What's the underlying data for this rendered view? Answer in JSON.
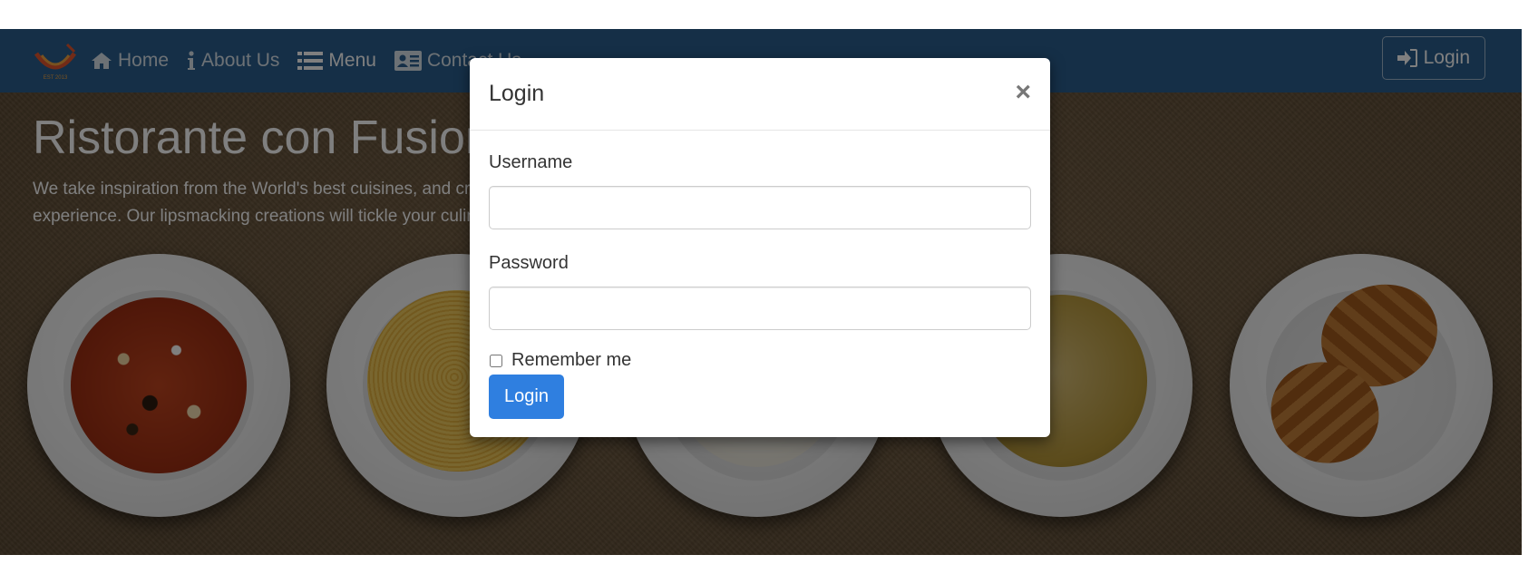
{
  "navbar": {
    "items": [
      {
        "label": "Home",
        "icon": "home-icon"
      },
      {
        "label": "About Us",
        "icon": "info-icon"
      },
      {
        "label": "Menu",
        "icon": "list-icon"
      },
      {
        "label": "Contact Us",
        "icon": "address-card-icon"
      }
    ],
    "active_item": "Menu",
    "login_label": "Login"
  },
  "hero": {
    "title": "Ristorante con Fusion",
    "text_line1": "We take inspiration from the World's best cuisines, and create a unique fusion",
    "text_line2": "experience. Our lipsmacking creations will tickle your culinary senses!"
  },
  "modal": {
    "title": "Login",
    "close_symbol": "×",
    "username_label": "Username",
    "username_value": "",
    "password_label": "Password",
    "password_value": "",
    "remember_label": "Remember me",
    "remember_checked": false,
    "submit_label": "Login"
  },
  "colors": {
    "navbar": "#2a5f8f",
    "primary_button": "#2f7fe0",
    "backdrop": "rgba(0,0,0,0.5)"
  }
}
